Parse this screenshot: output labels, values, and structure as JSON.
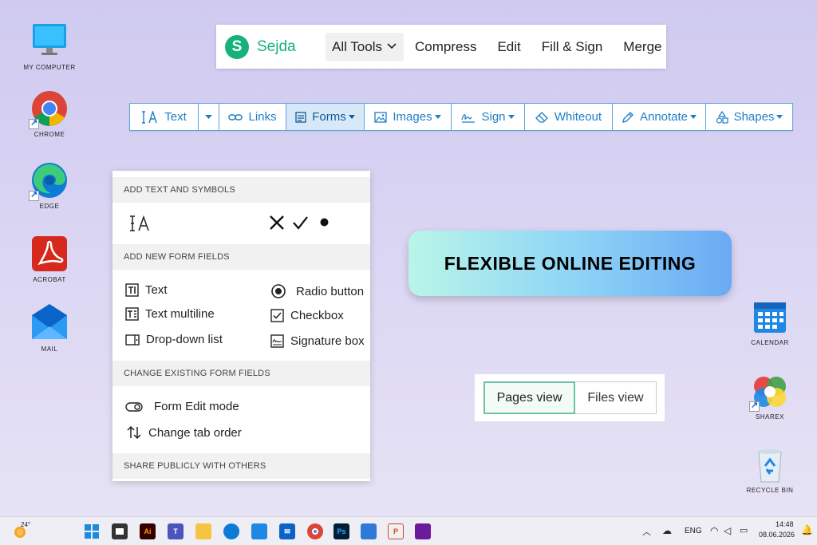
{
  "desktop": {
    "left_icons": [
      {
        "label": "MY COMPUTER",
        "icon": "monitor-icon"
      },
      {
        "label": "CHROME",
        "icon": "chrome-icon"
      },
      {
        "label": "EDGE",
        "icon": "edge-icon"
      },
      {
        "label": "ACROBAT",
        "icon": "acrobat-icon"
      },
      {
        "label": "MAIL",
        "icon": "mail-icon"
      }
    ],
    "right_icons": [
      {
        "label": "CALENDAR",
        "icon": "calendar-icon"
      },
      {
        "label": "SHAREX",
        "icon": "sharex-icon"
      },
      {
        "label": "RECYCLE BIN",
        "icon": "recycle-bin-icon"
      }
    ]
  },
  "sejda": {
    "logo_letter": "S",
    "logo_text": "Sejda",
    "all_tools": "All Tools",
    "menu": [
      "Compress",
      "Edit",
      "Fill & Sign",
      "Merge"
    ],
    "brand_color": "#17b27a"
  },
  "toolbar": {
    "text": "Text",
    "links": "Links",
    "forms": "Forms",
    "images": "Images",
    "sign": "Sign",
    "whiteout": "Whiteout",
    "annotate": "Annotate",
    "shapes": "Shapes",
    "accent": "#1f7fc5"
  },
  "forms_panel": {
    "sections": [
      "ADD TEXT AND SYMBOLS",
      "ADD NEW FORM FIELDS",
      "CHANGE EXISTING FORM FIELDS",
      "SHARE PUBLICLY WITH OTHERS"
    ],
    "symbols": [
      "IA",
      "✕",
      "✓",
      "●"
    ],
    "form_fields": {
      "text": "Text",
      "text_multiline": "Text multiline",
      "dropdown": "Drop-down list",
      "radio": "Radio button",
      "checkbox": "Checkbox",
      "signature": "Signature box"
    },
    "existing": {
      "edit_mode": "Form Edit mode",
      "tab_order": "Change tab order"
    }
  },
  "banner": {
    "text": "FLEXIBLE ONLINE EDITING"
  },
  "view_toggle": {
    "pages": "Pages view",
    "files": "Files view"
  },
  "taskbar": {
    "weather": "24°",
    "lang": "ENG",
    "time": "14:48",
    "date": "08.06.2026"
  }
}
